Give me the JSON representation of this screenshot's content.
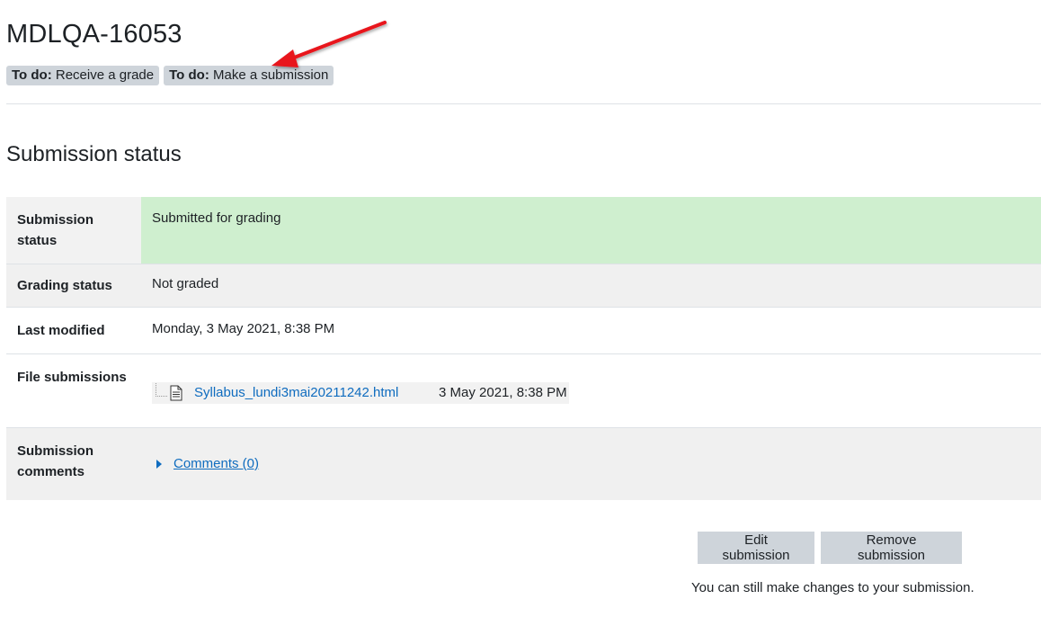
{
  "activity": {
    "title": "MDLQA-16053",
    "todos": [
      {
        "prefix": "To do:",
        "text": "Receive a grade"
      },
      {
        "prefix": "To do:",
        "text": "Make a submission"
      }
    ]
  },
  "section": {
    "title": "Submission status"
  },
  "status_table": {
    "submission_status": {
      "label": "Submission status",
      "value": "Submitted for grading"
    },
    "grading_status": {
      "label": "Grading status",
      "value": "Not graded"
    },
    "last_modified": {
      "label": "Last modified",
      "value": "Monday, 3 May 2021, 8:38 PM"
    },
    "file_submissions": {
      "label": "File submissions",
      "files": [
        {
          "name": "Syllabus_lundi3mai20211242.html",
          "date": "3 May 2021, 8:38 PM"
        }
      ]
    },
    "submission_comments": {
      "label": "Submission comments",
      "link": "Comments (0)"
    }
  },
  "actions": {
    "edit_label": "Edit submission",
    "remove_label": "Remove submission",
    "note": "You can still make changes to your submission."
  },
  "colors": {
    "submitted_bg": "#cfefcf",
    "link": "#0f6cbf",
    "badge_bg": "#ced4da",
    "arrow": "#e8141e"
  },
  "icons": {
    "file": "document-icon",
    "comments_toggle": "caret-right-icon",
    "annotation": "red-arrow-icon"
  }
}
